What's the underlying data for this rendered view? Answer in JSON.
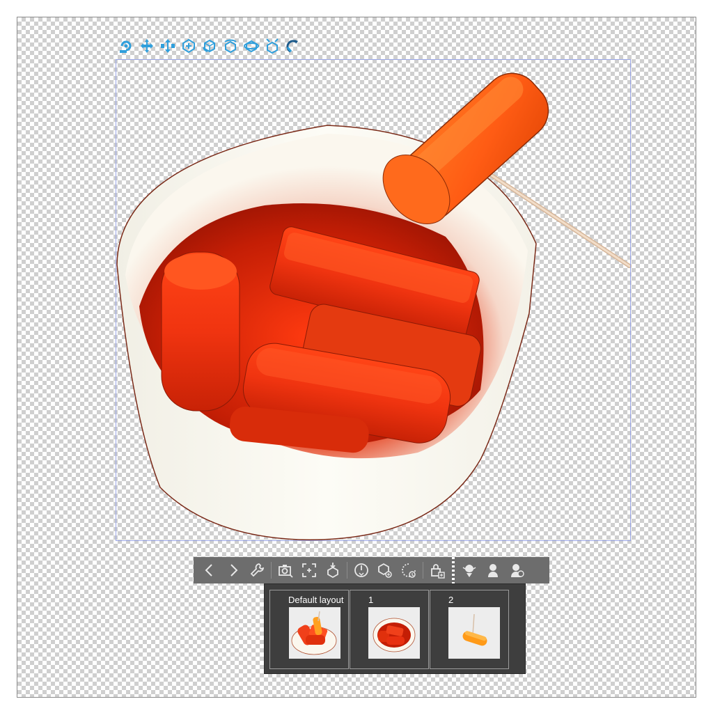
{
  "model_manipulator": {
    "icons": [
      "rotate-camera-icon",
      "pan-camera-icon",
      "dolly-camera-icon",
      "move-on-plane-icon",
      "rotate-object-icon",
      "rotate-object-view-icon",
      "rotate-object-axis-icon",
      "move-object-axis-icon",
      "snap-to-floor-icon"
    ]
  },
  "bottom_toolbar": {
    "icons": [
      "previous-object-icon",
      "next-object-icon",
      "object-settings-wrench-icon",
      "camera-angle-icon",
      "fit-to-canvas-icon",
      "place-on-ground-icon",
      "initial-position-icon",
      "object-list-icon",
      "reset-rotation-icon",
      "lock-add-icon",
      "hand-pose-icon",
      "full-body-pose-icon",
      "pose-register-icon"
    ]
  },
  "layout_panel": {
    "layouts": [
      {
        "label": "Default layout"
      },
      {
        "label": "1"
      },
      {
        "label": "2"
      }
    ]
  },
  "colors": {
    "accent_blue": "#2f9fdc",
    "toolbar_bg": "#6d6d6d",
    "panel_bg": "#3e3e3e",
    "sauce_red": "#d42a08",
    "rice_cake_red": "#ee3a12",
    "fishcake_orange": "#ff6a18",
    "cup_white": "#fbfaf2",
    "selection_border": "#9aa6e6"
  }
}
